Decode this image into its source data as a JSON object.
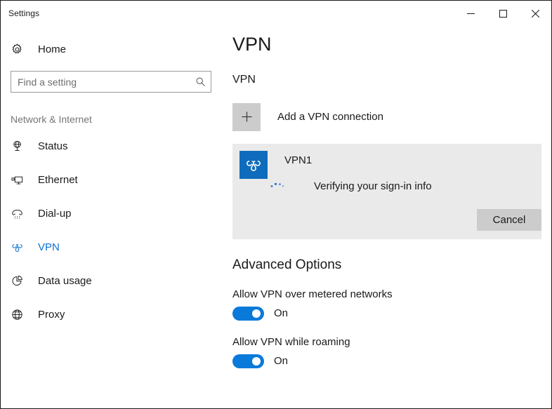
{
  "window": {
    "title": "Settings",
    "caption": {
      "minimize": "minimize-icon",
      "maximize": "maximize-icon",
      "close": "close-icon"
    }
  },
  "sidebar": {
    "home": {
      "label": "Home",
      "icon": "gear-icon"
    },
    "search": {
      "value": "",
      "placeholder": "Find a setting",
      "icon": "search-icon"
    },
    "section_header": "Network & Internet",
    "items": [
      {
        "label": "Status",
        "icon": "status-globe-icon",
        "selected": false
      },
      {
        "label": "Ethernet",
        "icon": "ethernet-monitor-icon",
        "selected": false
      },
      {
        "label": "Dial-up",
        "icon": "dialup-phone-icon",
        "selected": false
      },
      {
        "label": "VPN",
        "icon": "vpn-knot-icon",
        "selected": true
      },
      {
        "label": "Data usage",
        "icon": "pie-chart-icon",
        "selected": false
      },
      {
        "label": "Proxy",
        "icon": "globe-icon",
        "selected": false
      }
    ]
  },
  "main": {
    "page_title": "VPN",
    "vpn_section_header": "VPN",
    "add_connection": {
      "label": "Add a VPN connection",
      "icon": "plus-icon"
    },
    "connection": {
      "name": "VPN1",
      "icon": "vpn-knot-icon",
      "status": "Verifying your sign-in info",
      "spinner": "loading-spinner-icon",
      "cancel_label": "Cancel"
    },
    "advanced": {
      "title": "Advanced Options",
      "options": [
        {
          "label": "Allow VPN over metered networks",
          "state": "On",
          "on": true
        },
        {
          "label": "Allow VPN while roaming",
          "state": "On",
          "on": true
        }
      ]
    }
  },
  "colors": {
    "accent": "#0a7ada",
    "tile_blue": "#0f6cbd",
    "card_bg": "#eaeaea",
    "button_gray": "#cccccc",
    "selected_text": "#0a70d2"
  }
}
